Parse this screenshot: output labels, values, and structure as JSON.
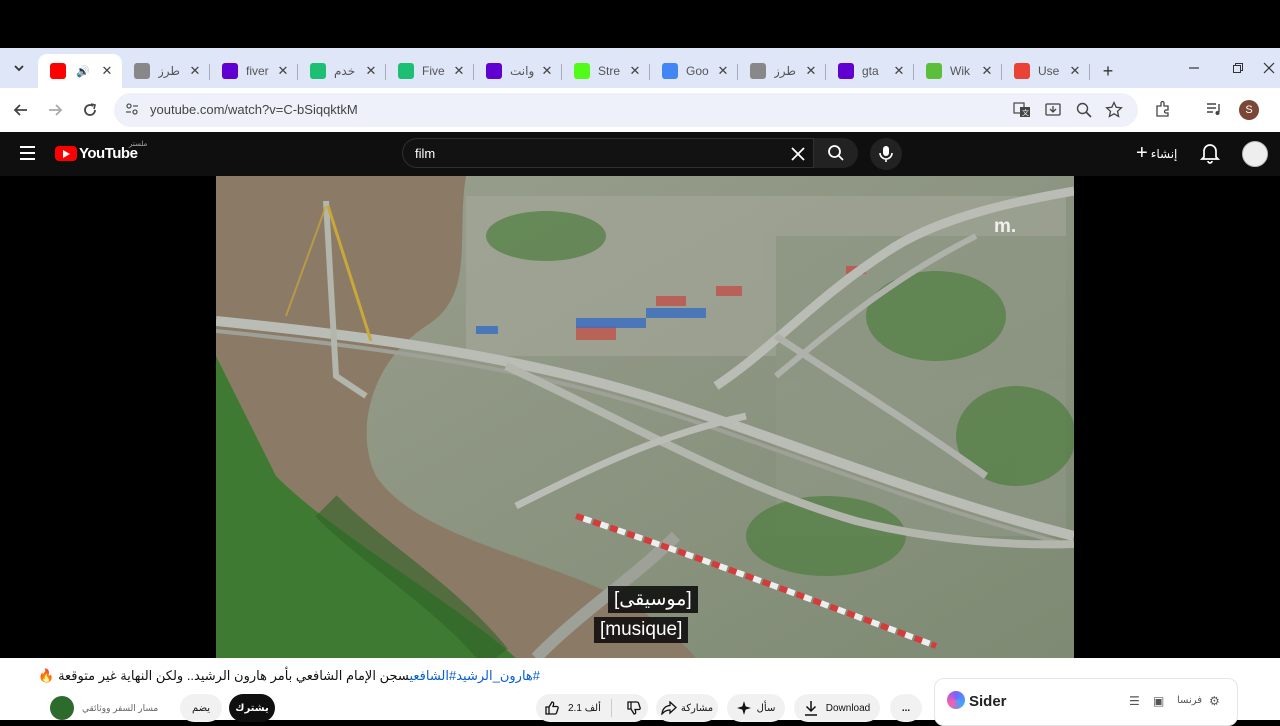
{
  "browser": {
    "tabs": [
      {
        "label": "",
        "icon": "youtube-icon",
        "color": "#ff0000",
        "active": true
      },
      {
        "label": "طرز",
        "icon": "openai-icon",
        "color": "#888888"
      },
      {
        "label": "fiver",
        "icon": "yahoo-icon",
        "color": "#6001d2"
      },
      {
        "label": "خدم",
        "icon": "fiverr-icon",
        "color": "#1dbf73"
      },
      {
        "label": "Five",
        "icon": "fiverr-icon",
        "color": "#1dbf73"
      },
      {
        "label": "وانت",
        "icon": "yahoo-icon",
        "color": "#6001d2"
      },
      {
        "label": "Stre",
        "icon": "kick-icon",
        "color": "#53fc18"
      },
      {
        "label": "Goo",
        "icon": "google-icon",
        "color": "#4285f4"
      },
      {
        "label": "طرز",
        "icon": "openai-icon",
        "color": "#888888"
      },
      {
        "label": "gta",
        "icon": "yahoo-icon",
        "color": "#6001d2"
      },
      {
        "label": "Wik",
        "icon": "leaf-icon",
        "color": "#5cbf3a"
      },
      {
        "label": "Use",
        "icon": "gmail-icon",
        "color": "#ea4335"
      }
    ],
    "url": "youtube.com/watch?v=C-bSiqqktkM",
    "profile_initial": "S"
  },
  "youtube": {
    "search_query": "film",
    "create_label": "إنشاء",
    "logo_text": "YouTube",
    "logo_sup": "ملستر",
    "watermark": "m.",
    "captions": [
      "[موسيقى]",
      "[musique]"
    ],
    "title_tags": "#هارون_الرشيد#الشافعي",
    "title_text": "سجن الإمام الشافعي بأمر هارون الرشيد.. ولكن النهاية غير متوقعة 🔥",
    "channel_name": "مسار السفر ووثائقي",
    "subscribe_label": "يشترك",
    "join_label": "يضم",
    "like_count": "2.1 ألف",
    "share_label": "مشاركة",
    "ask_label": "سأل",
    "download_label": "Download",
    "more_label": "...",
    "sider_name": "Sider",
    "sider_lang": "فرنسا"
  }
}
